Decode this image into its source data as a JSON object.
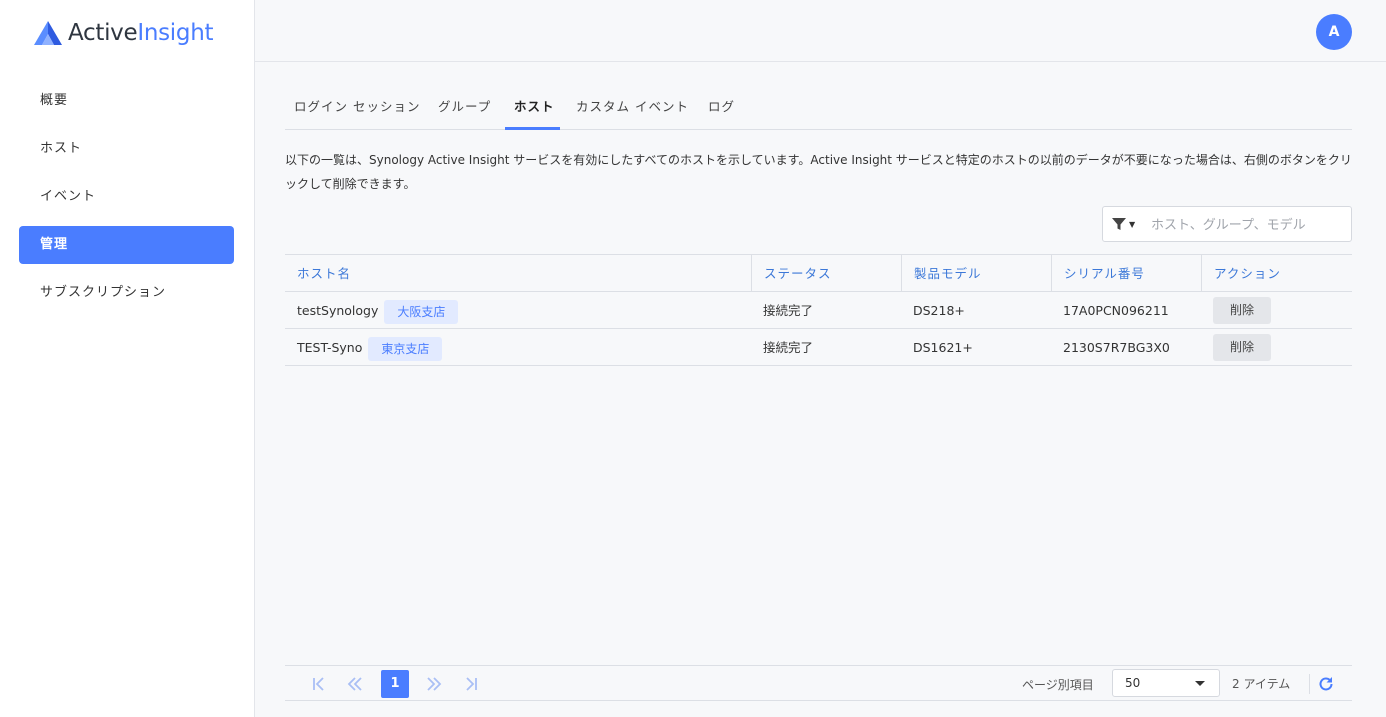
{
  "logo": {
    "part1": "Active",
    "part2": "Insight"
  },
  "colors": {
    "accent": "#4a7dff",
    "tag_bg": "#e2eaff",
    "header_text": "#3c78d8"
  },
  "sidebar": {
    "items": [
      {
        "label": "概要",
        "active": false
      },
      {
        "label": "ホスト",
        "active": false
      },
      {
        "label": "イベント",
        "active": false
      },
      {
        "label": "管理",
        "active": true
      },
      {
        "label": "サブスクリプション",
        "active": false
      }
    ]
  },
  "user": {
    "avatar_initial": "A"
  },
  "tabs": [
    {
      "label": "ログイン セッション"
    },
    {
      "label": "グループ"
    },
    {
      "label": "ホスト",
      "active": true
    },
    {
      "label": "カスタム イベント"
    },
    {
      "label": "ログ"
    }
  ],
  "description": "以下の一覧は、Synology Active Insight サービスを有効にしたすべてのホストを示しています。Active Insight サービスと特定のホストの以前のデータが不要になった場合は、右側のボタンをクリックして削除できます。",
  "filter": {
    "icon": "filter-icon",
    "placeholder": "ホスト、グループ、モデル"
  },
  "table": {
    "columns": [
      "ホスト名",
      "ステータス",
      "製品モデル",
      "シリアル番号",
      "アクション"
    ],
    "rows": [
      {
        "host": "testSynology",
        "group": "大阪支店",
        "status": "接続完了",
        "model": "DS218+",
        "serial": "17A0PCN096211",
        "action": "削除"
      },
      {
        "host": "TEST-Syno",
        "group": "東京支店",
        "status": "接続完了",
        "model": "DS1621+",
        "serial": "2130S7R7BG3X0",
        "action": "削除"
      }
    ]
  },
  "pagination": {
    "current_page": "1",
    "per_page_label": "ページ別項目",
    "per_page_value": "50",
    "item_count": "2 アイテム"
  }
}
